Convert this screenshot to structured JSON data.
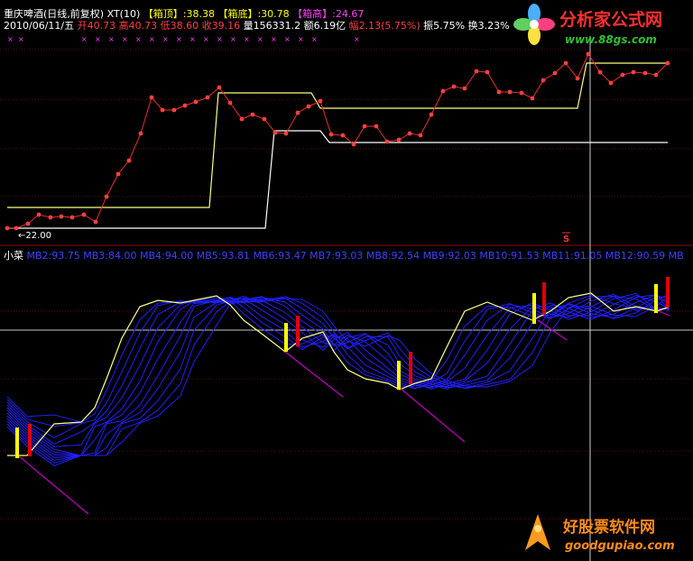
{
  "header": {
    "stock_name": "重庆啤酒(日线,前复权)",
    "indicator": "XT(10)",
    "box_top_label": "【箱顶】",
    "box_top_value": ":38.38",
    "box_bottom_label": "【箱底】",
    "box_bottom_value": ":30.78",
    "box_high_label": "【箱高】",
    "box_high_value": ":24.67"
  },
  "quote": {
    "date": "2010/06/11/五",
    "open": "开40.73",
    "high": "高40.73",
    "low": "低38.60",
    "close": "收39.16",
    "volume": "量156331.2",
    "amount": "额6.19亿",
    "change": "幅2.13(5.75%)",
    "amplitude": "振5.75%",
    "turnover": "换3.23%"
  },
  "price_marker": "←22.00",
  "s_marker": "S",
  "lower_panel": {
    "name": "小菜",
    "ma_labels": [
      "MB2:93.75",
      "MB3:84.00",
      "MB4:94.00",
      "MB5:93.81",
      "MB6:93.47",
      "MB7:93.03",
      "MB8:92.54",
      "MB9:92.03",
      "MB10:91.53",
      "MB11:91.05",
      "MB12:90.59",
      "MB"
    ]
  },
  "watermark_top": {
    "title": "分析家公式网",
    "url": "www.88gs.com",
    "icon": "pinwheel-logo-icon"
  },
  "watermark_bottom": {
    "title": "好股票软件网",
    "url": "goodgupiao.com",
    "icon": "rocket-logo-icon"
  },
  "colors": {
    "price_line": "#e83030",
    "price_dot": "#ff4040",
    "box_line": "#ffffff",
    "box_line_alt": "#ffff80",
    "ma_fan": "#2020ff",
    "signal_yellow": "#ffff00",
    "signal_red": "#e00000",
    "trend_magenta": "#c000c0",
    "header_red": "#ff4040",
    "header_yellow": "#ffff00",
    "header_magenta": "#ff40ff",
    "ma_label_blue": "#4040ff"
  }
}
